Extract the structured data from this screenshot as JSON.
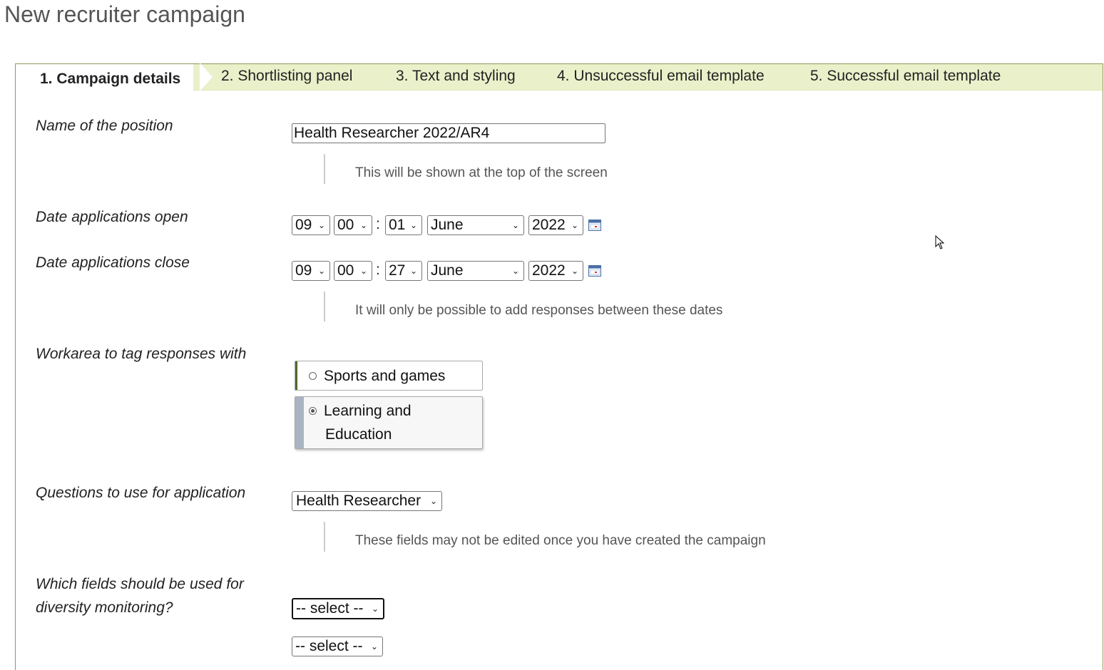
{
  "page": {
    "title": "New recruiter campaign"
  },
  "tabs": [
    {
      "label": "1. Campaign details",
      "active": true
    },
    {
      "label": "2. Shortlisting panel"
    },
    {
      "label": "3. Text and styling"
    },
    {
      "label": "4. Unsuccessful email template"
    },
    {
      "label": "5. Successful email template"
    }
  ],
  "form": {
    "position": {
      "label": "Name of the position",
      "value": "Health Researcher 2022/AR4",
      "hint": "This will be shown at the top of the screen"
    },
    "date_open": {
      "label": "Date applications open",
      "hour": "09",
      "minute": "00",
      "separator": ":",
      "day": "01",
      "month": "June",
      "year": "2022"
    },
    "date_close": {
      "label": "Date applications close",
      "hour": "09",
      "minute": "00",
      "separator": ":",
      "day": "27",
      "month": "June",
      "year": "2022",
      "hint": "It will only be possible to add responses between these dates"
    },
    "workarea": {
      "label": "Workarea to tag responses with",
      "options": [
        {
          "label": "Sports and games",
          "selected": false
        },
        {
          "label_line1": "Learning and",
          "label_line2": "Education",
          "selected": true
        }
      ]
    },
    "questions": {
      "label": "Questions to use for application",
      "value": "Health Researcher",
      "hint": "These fields may not be edited once you have created the campaign"
    },
    "diversity": {
      "label_line1": "Which fields should be used for",
      "label_line2": "diversity monitoring?",
      "select1": "-- select --",
      "select2": "-- select --"
    }
  },
  "icons": {
    "calendar": "calendar-icon",
    "select_arrow": "chevron-down-icon",
    "cursor": "mouse-pointer-icon"
  },
  "colors": {
    "tab_bar": "#eaf0c9",
    "panel_border": "#8a9a5b",
    "radio_bar_unselected": "#4e6a2e",
    "radio_bar_selected": "#a9b4c2"
  }
}
